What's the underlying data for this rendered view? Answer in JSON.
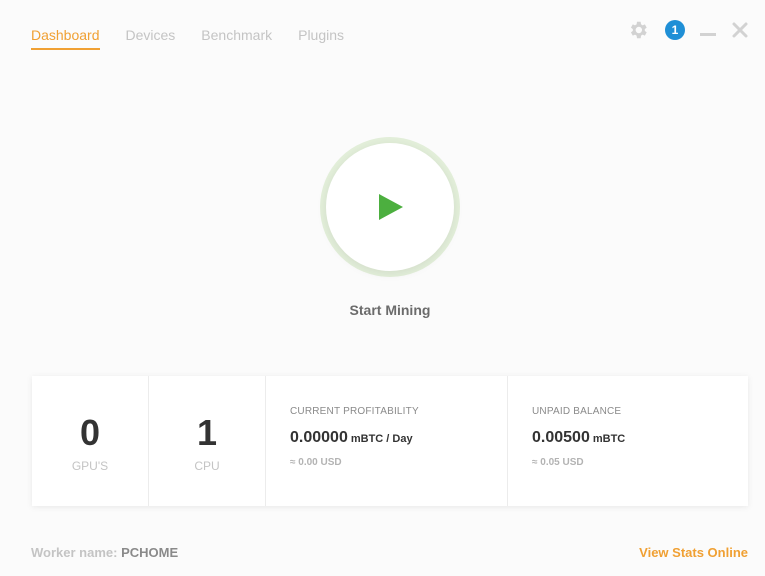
{
  "tabs": [
    {
      "label": "Dashboard",
      "active": true
    },
    {
      "label": "Devices",
      "active": false
    },
    {
      "label": "Benchmark",
      "active": false
    },
    {
      "label": "Plugins",
      "active": false
    }
  ],
  "header": {
    "notification_count": "1",
    "icons": [
      "gear-icon",
      "minimize-icon",
      "close-icon"
    ]
  },
  "mining": {
    "start_label": "Start Mining",
    "play_icon": "play-icon",
    "play_color": "#4caf3f"
  },
  "stats": {
    "gpus": {
      "value": "0",
      "label": "GPU'S"
    },
    "cpu": {
      "value": "1",
      "label": "CPU"
    },
    "profitability": {
      "title": "CURRENT PROFITABILITY",
      "value": "0.00000",
      "unit": "mBTC / Day",
      "usd": "≈ 0.00 USD"
    },
    "balance": {
      "title": "UNPAID BALANCE",
      "value": "0.00500",
      "unit": "mBTC",
      "usd": "≈ 0.05 USD"
    }
  },
  "footer": {
    "worker_label": "Worker name:",
    "worker_name": "PCHOME",
    "view_stats": "View Stats Online"
  },
  "colors": {
    "accent": "#f0a033",
    "notification": "#1f8fd6",
    "play_ring": "#e3efda"
  }
}
